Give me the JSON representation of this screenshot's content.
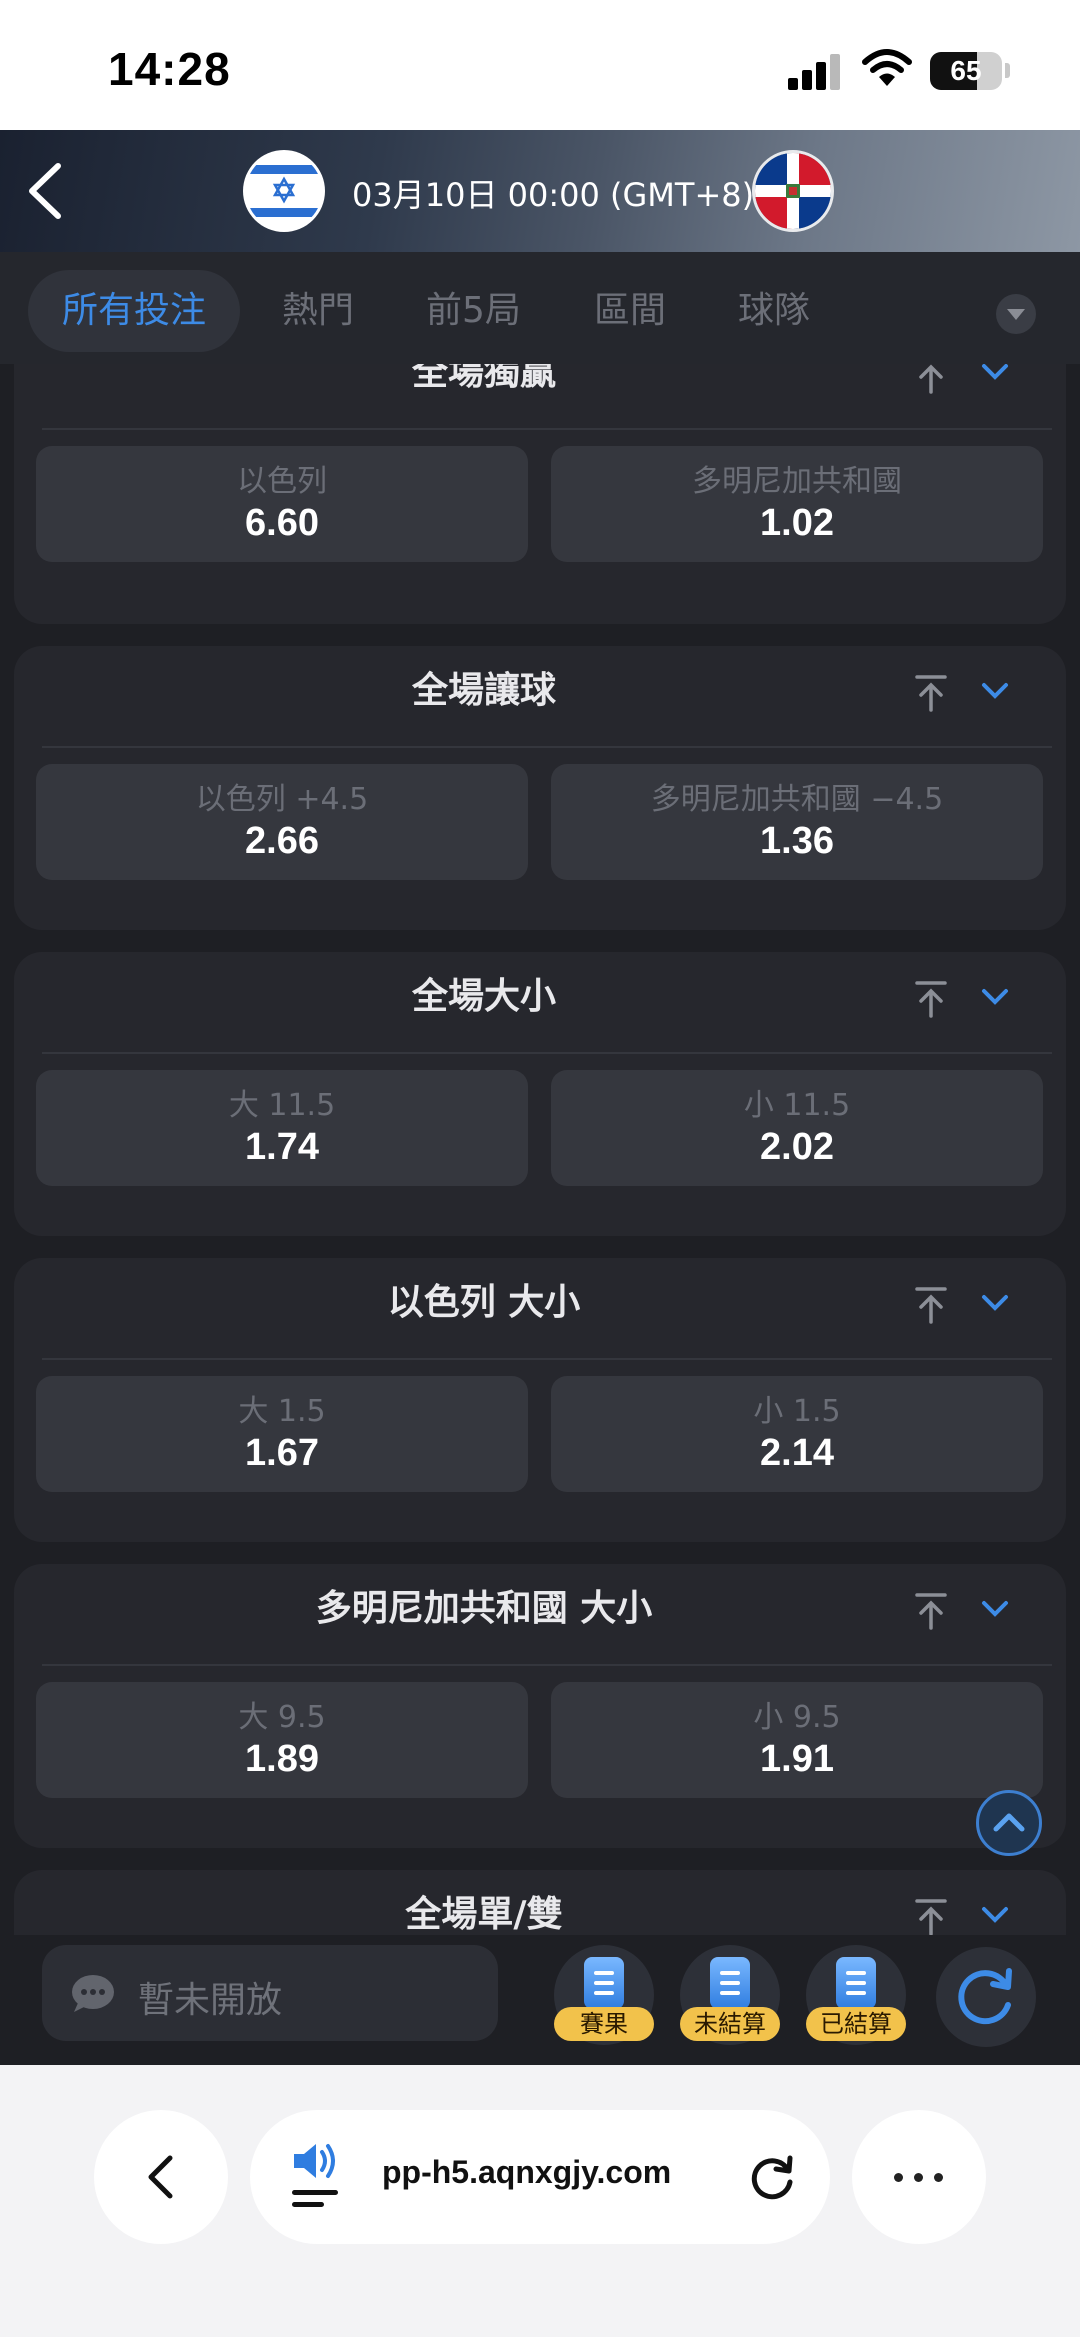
{
  "status_bar": {
    "time": "14:28",
    "battery": "65",
    "battery_level": 0.65
  },
  "match": {
    "datetime": "03月10日 00:00 (GMT+8)",
    "home_flag": "israel-flag",
    "away_flag": "dominican-republic-flag"
  },
  "tabs": [
    {
      "label": "所有投注",
      "active": true
    },
    {
      "label": "熱門",
      "active": false
    },
    {
      "label": "前5局",
      "active": false
    },
    {
      "label": "區間",
      "active": false
    },
    {
      "label": "球隊",
      "active": false
    }
  ],
  "markets": [
    {
      "title": "全場獨贏",
      "left": {
        "label": "以色列",
        "odds": "6.60"
      },
      "right": {
        "label": "多明尼加共和國",
        "odds": "1.02"
      }
    },
    {
      "title": "全場讓球",
      "left": {
        "label": "以色列 +4.5",
        "odds": "2.66"
      },
      "right": {
        "label": "多明尼加共和國 −4.5",
        "odds": "1.36"
      }
    },
    {
      "title": "全場大小",
      "left": {
        "label": "大 11.5",
        "odds": "1.74"
      },
      "right": {
        "label": "小 11.5",
        "odds": "2.02"
      }
    },
    {
      "title": "以色列 大小",
      "left": {
        "label": "大 1.5",
        "odds": "1.67"
      },
      "right": {
        "label": "小 1.5",
        "odds": "2.14"
      }
    },
    {
      "title": "多明尼加共和國 大小",
      "left": {
        "label": "大 9.5",
        "odds": "1.89"
      },
      "right": {
        "label": "小 9.5",
        "odds": "1.91"
      }
    },
    {
      "title": "全場單/雙"
    }
  ],
  "bottom_bar": {
    "chat_placeholder": "暫未開放",
    "buttons": [
      {
        "label": "賽果",
        "icon": "clipboard-icon"
      },
      {
        "label": "未結算",
        "icon": "clipboard-icon"
      },
      {
        "label": "已結算",
        "icon": "clipboard-icon"
      }
    ]
  },
  "browser": {
    "url": "pp-h5.aqnxgjy.com"
  },
  "colors": {
    "accent": "#3d8be6",
    "background": "#1e1f24",
    "card": "#26272d",
    "button": "#35373e",
    "badge": "#f2c24b"
  }
}
